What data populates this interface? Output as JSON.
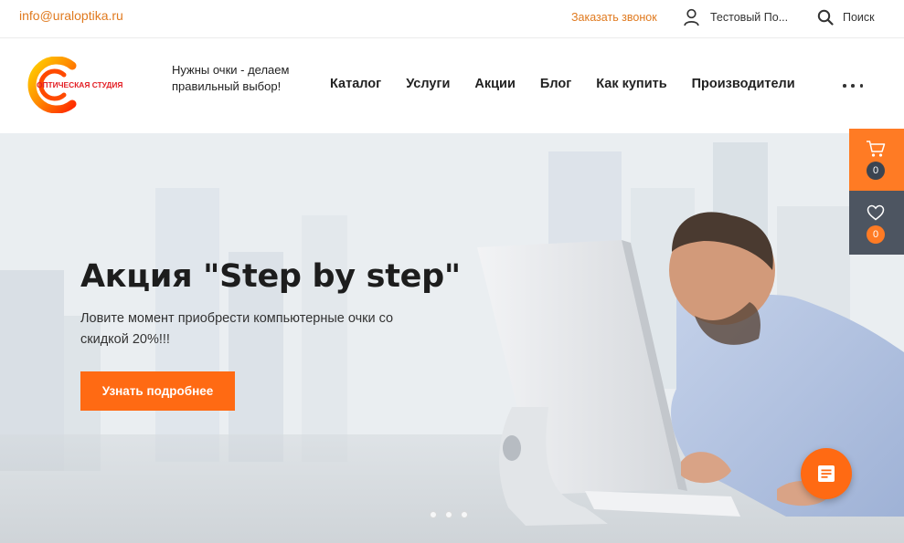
{
  "topbar": {
    "email": "info@uraloptika.ru",
    "callback": "Заказать звонок",
    "user_label": "Тестовый По...",
    "search_label": "Поиск"
  },
  "header": {
    "logo_text": "ОПТИЧЕСКАЯ СТУДИЯ",
    "tagline": "Нужны очки - делаем правильный выбор!",
    "nav": [
      "Каталог",
      "Услуги",
      "Акции",
      "Блог",
      "Как купить",
      "Производители"
    ]
  },
  "hero": {
    "title": "Акция \"Step by step\"",
    "subtitle": "Ловите момент приобрести компьютерные очки со скидкой 20%!!!",
    "cta": "Узнать подробнее",
    "slide_count": 3
  },
  "side": {
    "cart_count": "0",
    "favorites_count": "0"
  },
  "colors": {
    "accent": "#ff6a13",
    "link": "#e07a1f",
    "dark_panel": "#4d5561"
  },
  "icons": {
    "user": "user-icon",
    "search": "search-icon",
    "more": "more-dots-icon",
    "cart": "cart-icon",
    "favorites": "heart-icon",
    "chat": "chat-icon"
  }
}
